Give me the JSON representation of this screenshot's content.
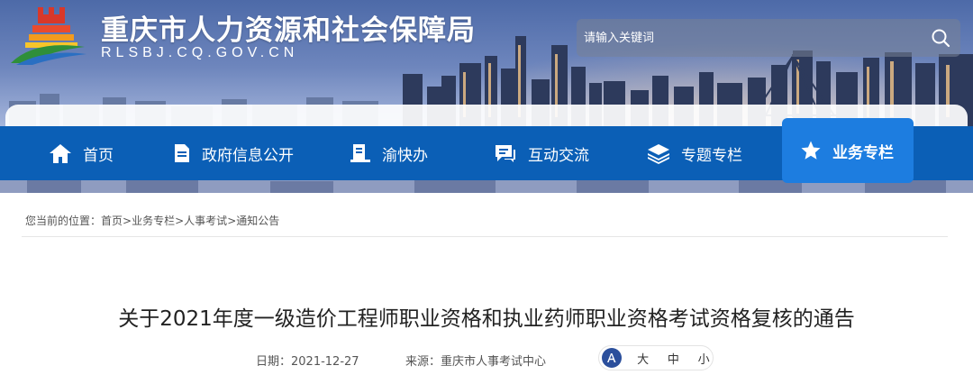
{
  "header": {
    "site_title": "重庆市人力资源和社会保障局",
    "site_domain": "RLSBJ.CQ.GOV.CN",
    "search_placeholder": "请输入关键词"
  },
  "nav": {
    "items": [
      {
        "label": "首页",
        "icon": "home-icon"
      },
      {
        "label": "政府信息公开",
        "icon": "document-icon"
      },
      {
        "label": "渝快办",
        "icon": "service-icon"
      },
      {
        "label": "互动交流",
        "icon": "chat-icon"
      },
      {
        "label": "专题专栏",
        "icon": "layers-icon"
      },
      {
        "label": "业务专栏",
        "icon": "star-icon",
        "active": true
      }
    ]
  },
  "breadcrumb": {
    "prefix": "您当前的位置：",
    "items": [
      "首页",
      "业务专栏",
      "人事考试",
      "通知公告"
    ],
    "separator": ">"
  },
  "article": {
    "title": "关于2021年度一级造价工程师职业资格和执业药师职业资格考试资格复核的通告",
    "date_label": "日期：",
    "date": "2021-12-27",
    "source_label": "来源：",
    "source": "重庆市人事考试中心",
    "font_sizes": [
      "大",
      "中",
      "小"
    ]
  },
  "colors": {
    "nav_bg": "#0b5fb6",
    "nav_active": "#1d7de0",
    "font_icon": "#2b4f9c"
  }
}
